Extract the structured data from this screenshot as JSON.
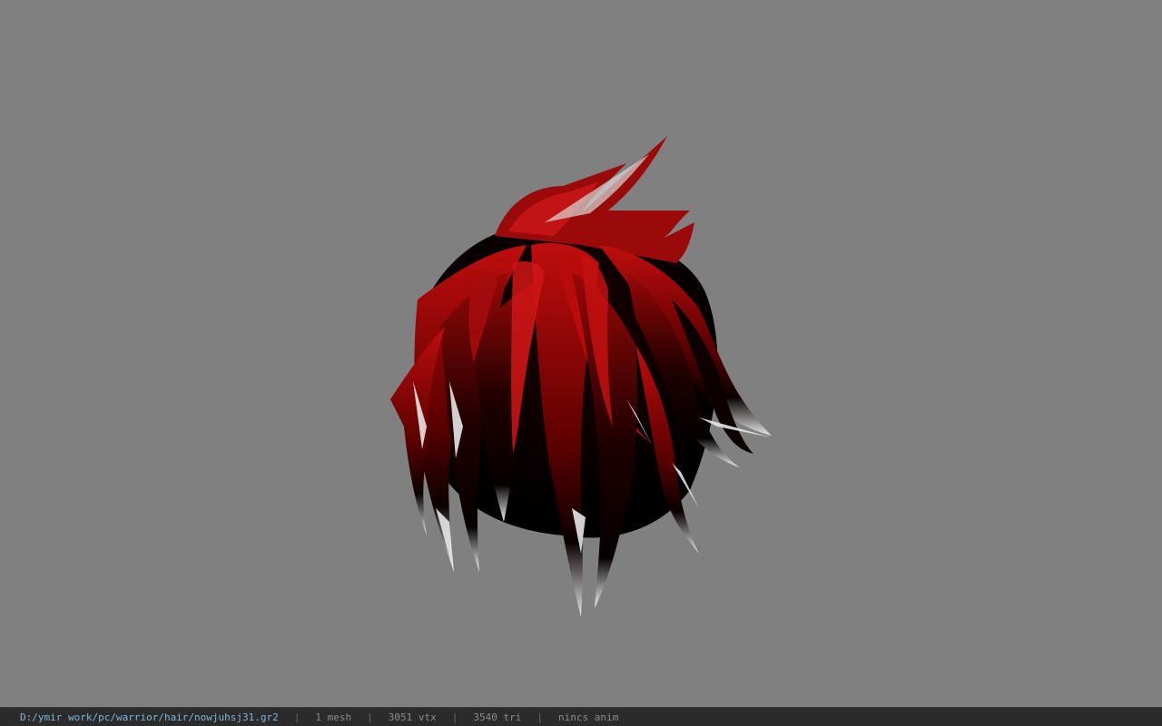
{
  "viewer": {
    "background_color": "#808080",
    "model": {
      "kind": "hair-mesh",
      "colors": {
        "base": "#b00a0a",
        "dark": "#0a0000",
        "tips": "#e8e8e8"
      }
    }
  },
  "statusbar": {
    "file_path": "D:/ymir work/pc/warrior/hair/nowjuhsj31.gr2",
    "separator": "|",
    "mesh_count": "1 mesh",
    "vertex_count": "3051 vtx",
    "triangle_count": "3540 tri",
    "anim_status": "nincs anim"
  }
}
